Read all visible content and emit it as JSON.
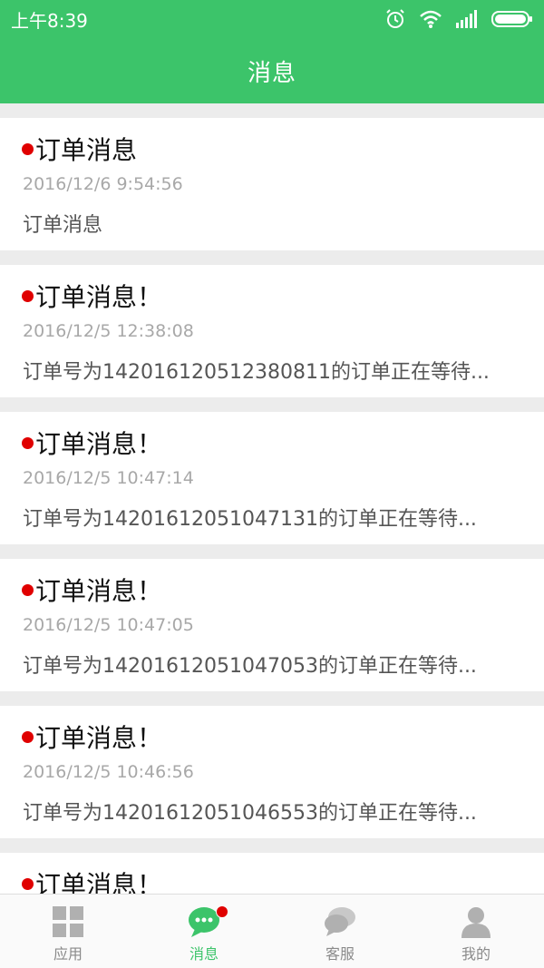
{
  "status_bar": {
    "time": "上午8:39",
    "icons": [
      "alarm-icon",
      "wifi-icon",
      "signal-icon",
      "battery-icon"
    ]
  },
  "header": {
    "title": "消息"
  },
  "messages": [
    {
      "title": "订单消息",
      "time": "2016/12/6 9:54:56",
      "body": "订单消息",
      "unread": true
    },
    {
      "title": "订单消息！",
      "time": "2016/12/5 12:38:08",
      "body": "订单号为14201612051238081​1的订单正在等待...",
      "unread": true
    },
    {
      "title": "订单消息！",
      "time": "2016/12/5 10:47:14",
      "body": "订单号为14201612051047131的订单正在等待...",
      "unread": true
    },
    {
      "title": "订单消息！",
      "time": "2016/12/5 10:47:05",
      "body": "订单号为14201612051047053的订单正在等待...",
      "unread": true
    },
    {
      "title": "订单消息！",
      "time": "2016/12/5 10:46:56",
      "body": "订单号为14201612051046553的订单正在等待...",
      "unread": true
    },
    {
      "title": "订单消息！",
      "time": "",
      "body": "",
      "unread": true
    }
  ],
  "tabs": [
    {
      "label": "应用",
      "icon": "grid-icon",
      "active": false
    },
    {
      "label": "消息",
      "icon": "chat-icon",
      "active": true
    },
    {
      "label": "客服",
      "icon": "service-chat-icon",
      "active": false
    },
    {
      "label": "我的",
      "icon": "user-icon",
      "active": false
    }
  ],
  "colors": {
    "primary": "#3cc46a",
    "badge": "#e00000",
    "tab_inactive": "#b0b0b0"
  }
}
